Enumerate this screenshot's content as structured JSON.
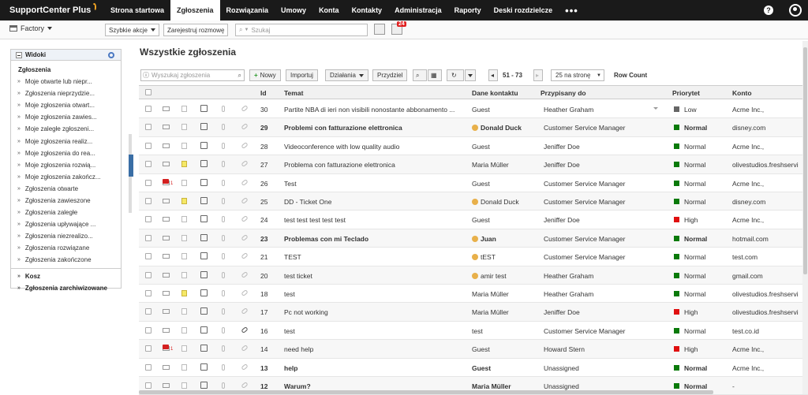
{
  "app": {
    "logo": "SupportCenter Plus"
  },
  "topnav": {
    "tabs": [
      "Strona startowa",
      "Zgłoszenia",
      "Rozwiązania",
      "Umowy",
      "Konta",
      "Kontakty",
      "Administracja",
      "Raporty",
      "Deski rozdzielcze"
    ],
    "active_tab": "Zgłoszenia",
    "more": "•••",
    "help_icon": "question-circle-icon",
    "user_icon": "user-circle-icon"
  },
  "toolbar2": {
    "site": "Factory",
    "quick_actions": "Szybkie akcje",
    "log_call": "Zarejestruj rozmowę",
    "search_placeholder": "Szukaj",
    "reminders_badge": "24"
  },
  "sidebar": {
    "header": "Widoki",
    "section": "Zgłoszenia",
    "items": [
      "Moje otwarte lub niepr...",
      "Zgłoszenia nieprzydzie...",
      "Moje zgłoszenia otwart...",
      "Moje zgłoszenia zawies...",
      "Moje zaległe zgłoszeni...",
      "Moje zgłoszenia realiz...",
      "Moje zgłoszenia do rea...",
      "Moje zgłoszenia rozwią...",
      "Moje zgłoszenia zakończ...",
      "Zgłoszenia otwarte",
      "Zgłoszenia zawieszone",
      "Zgłoszenia zaległe",
      "Zgłoszenia upływające ...",
      "Zgłoszenia niezrealizo...",
      "Zgłoszenia rozwiązane",
      "Zgłoszenia zakończone"
    ],
    "trash": "Kosz",
    "archived": "Zgłoszenia zarchiwizowane"
  },
  "main": {
    "title": "Wszystkie zgłoszenia",
    "search_placeholder": "Wyszukaj zgłoszenia",
    "new_label": "Nowy",
    "import_label": "Importuj",
    "actions_label": "Działania",
    "assign_label": "Przydziel",
    "page_range": "51 - 73",
    "per_page": "25 na stronę",
    "row_count": "Row Count"
  },
  "table": {
    "columns": {
      "id": "Id",
      "subject": "Temat",
      "contact": "Dane kontaktu",
      "assignee": "Przypisany do",
      "priority": "Priorytet",
      "account": "Konto"
    },
    "rows": [
      {
        "id": "30",
        "subject": "Partite NBA di ieri non visibili nonostante abbonamento ...",
        "contact": "Guest",
        "assignee": "Heather Graham",
        "priority": "Low",
        "account": "Acme Inc.,",
        "bold": false,
        "note": false,
        "alarm": false,
        "person": false
      },
      {
        "id": "29",
        "subject": "Problemi con fatturazione elettronica",
        "contact": "Donald Duck",
        "assignee": "Customer Service Manager",
        "priority": "Normal",
        "account": "disney.com",
        "bold": true,
        "note": false,
        "alarm": false,
        "person": true
      },
      {
        "id": "28",
        "subject": "Videoconference with low quality audio",
        "contact": "Guest",
        "assignee": "Jeniffer Doe",
        "priority": "Normal",
        "account": "Acme Inc.,",
        "bold": false,
        "note": false,
        "alarm": false,
        "person": false
      },
      {
        "id": "27",
        "subject": "Problema con fatturazione elettronica",
        "contact": "Maria Müller",
        "assignee": "Jeniffer Doe",
        "priority": "Normal",
        "account": "olivestudios.freshservi",
        "bold": false,
        "note": true,
        "alarm": false,
        "person": false
      },
      {
        "id": "26",
        "subject": "Test",
        "contact": "Guest",
        "assignee": "Customer Service Manager",
        "priority": "Normal",
        "account": "Acme Inc.,",
        "bold": false,
        "note": false,
        "alarm": true,
        "person": false
      },
      {
        "id": "25",
        "subject": "DD - Ticket One",
        "contact": "Donald Duck",
        "assignee": "Customer Service Manager",
        "priority": "Normal",
        "account": "disney.com",
        "bold": false,
        "note": true,
        "alarm": false,
        "person": true
      },
      {
        "id": "24",
        "subject": "test test test test test",
        "contact": "Guest",
        "assignee": "Jeniffer Doe",
        "priority": "High",
        "account": "Acme Inc.,",
        "bold": false,
        "note": false,
        "alarm": false,
        "person": false
      },
      {
        "id": "23",
        "subject": "Problemas con mi Teclado",
        "contact": "Juan",
        "assignee": "Customer Service Manager",
        "priority": "Normal",
        "account": "hotmail.com",
        "bold": true,
        "note": false,
        "alarm": false,
        "person": true
      },
      {
        "id": "21",
        "subject": "TEST",
        "contact": "tEST",
        "assignee": "Customer Service Manager",
        "priority": "Normal",
        "account": "test.com",
        "bold": false,
        "note": false,
        "alarm": false,
        "person": true
      },
      {
        "id": "20",
        "subject": "test ticket",
        "contact": "amir test",
        "assignee": "Heather Graham",
        "priority": "Normal",
        "account": "gmail.com",
        "bold": false,
        "note": false,
        "alarm": false,
        "person": true
      },
      {
        "id": "18",
        "subject": "test",
        "contact": "Maria Müller",
        "assignee": "Heather Graham",
        "priority": "Normal",
        "account": "olivestudios.freshservi",
        "bold": false,
        "note": true,
        "alarm": false,
        "person": false
      },
      {
        "id": "17",
        "subject": "Pc not working",
        "contact": "Maria Müller",
        "assignee": "Jeniffer Doe",
        "priority": "High",
        "account": "olivestudios.freshservi",
        "bold": false,
        "note": false,
        "alarm": false,
        "person": false
      },
      {
        "id": "16",
        "subject": "test",
        "contact": "test",
        "assignee": "Customer Service Manager",
        "priority": "Normal",
        "account": "test.co.id",
        "bold": false,
        "note": false,
        "alarm": false,
        "person": false,
        "link": true
      },
      {
        "id": "14",
        "subject": "need help",
        "contact": "Guest",
        "assignee": "Howard Stern",
        "priority": "High",
        "account": "Acme Inc.,",
        "bold": false,
        "note": false,
        "alarm": true,
        "person": false
      },
      {
        "id": "13",
        "subject": "help",
        "contact": "Guest",
        "assignee": "Unassigned",
        "priority": "Normal",
        "account": "Acme Inc.,",
        "bold": true,
        "note": false,
        "alarm": false,
        "person": false
      },
      {
        "id": "12",
        "subject": "Warum?",
        "contact": "Maria Müller",
        "assignee": "Unassigned",
        "priority": "Normal",
        "account": "-",
        "bold": true,
        "note": false,
        "alarm": false,
        "person": false
      }
    ]
  }
}
